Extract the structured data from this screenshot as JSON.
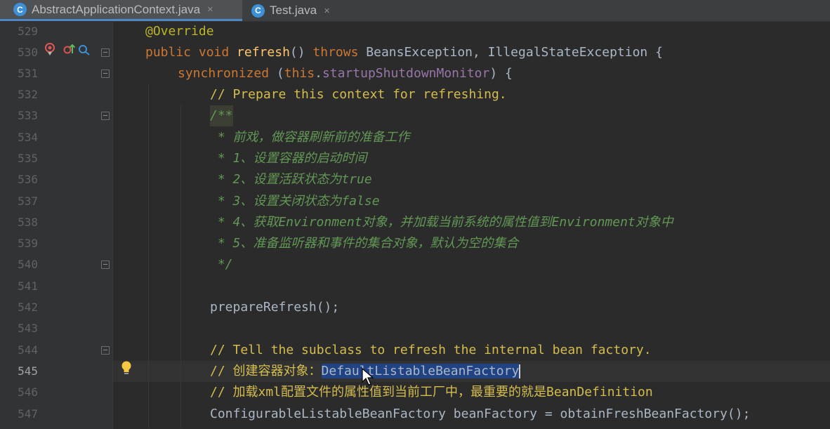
{
  "tabs": [
    {
      "icon_letter": "C",
      "label": "AbstractApplicationContext.java",
      "active": true,
      "close": "×"
    },
    {
      "icon_letter": "C",
      "label": "Test.java",
      "active": false,
      "close": "×"
    }
  ],
  "gutter": {
    "line_numbers": [
      "529",
      "530",
      "531",
      "532",
      "533",
      "534",
      "535",
      "536",
      "537",
      "538",
      "539",
      "540",
      "541",
      "542",
      "543",
      "544",
      "545",
      "546",
      "547"
    ],
    "current_line": "545",
    "icons": [
      "breakpoint-override-icon",
      "override-up-icon",
      "search-usages-icon",
      "lightbulb-icon"
    ]
  },
  "code": {
    "l529": "@Override",
    "l530": {
      "kw1": "public void ",
      "fn": "refresh",
      "p1": "() ",
      "kw2": "throws ",
      "rest": "BeansException, IllegalStateException {"
    },
    "l531": {
      "kw": "synchronized ",
      "p1": "(",
      "kw2": "this",
      "p2": ".",
      "fld": "startupShutdownMonitor",
      "p3": ") {"
    },
    "l532": "// Prepare this context for refreshing.",
    "l533": "/**",
    "l534": " * 前戏，做容器刷新前的准备工作",
    "l535": " * 1、设置容器的启动时间",
    "l536": " * 2、设置活跃状态为true",
    "l537": " * 3、设置关闭状态为false",
    "l538": " * 4、获取Environment对象，并加载当前系统的属性值到Environment对象中",
    "l539": " * 5、准备监听器和事件的集合对象，默认为空的集合",
    "l540": " */",
    "l542": "prepareRefresh();",
    "l544": "// Tell the subclass to refresh the internal bean factory.",
    "l545": {
      "prefix": "// 创建容器对象：",
      "selected": "DefaultListableBeanFactory"
    },
    "l546": "// 加载xml配置文件的属性值到当前工厂中，最重要的就是BeanDefinition",
    "l547": "ConfigurableListableBeanFactory beanFactory = obtainFreshBeanFactory();"
  },
  "colors": {
    "background": "#2b2b2b",
    "keyword": "#cc7832",
    "method": "#ffc66d",
    "annotation": "#bbb529",
    "field": "#9876aa",
    "line_comment": "#d4bd4e",
    "doc_comment": "#629755",
    "selection": "#214283"
  }
}
